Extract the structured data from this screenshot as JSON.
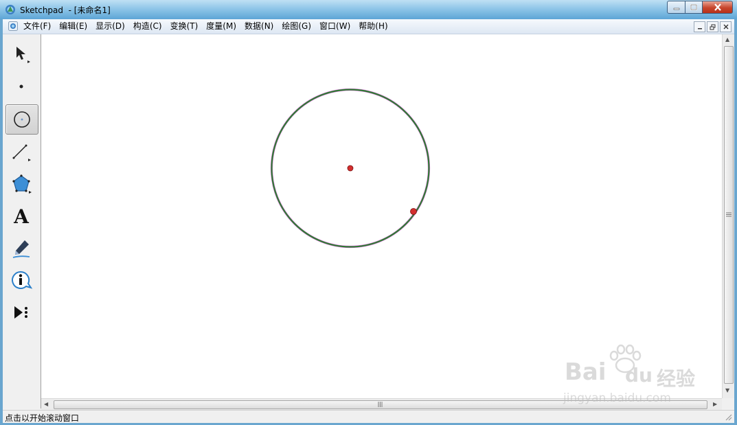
{
  "window": {
    "title": "Sketchpad  - [未命名1]"
  },
  "menubar": {
    "items": [
      {
        "label": "文件(F)"
      },
      {
        "label": "编辑(E)"
      },
      {
        "label": "显示(D)"
      },
      {
        "label": "构造(C)"
      },
      {
        "label": "变换(T)"
      },
      {
        "label": "度量(M)"
      },
      {
        "label": "数据(N)"
      },
      {
        "label": "绘图(G)"
      },
      {
        "label": "窗口(W)"
      },
      {
        "label": "帮助(H)"
      }
    ]
  },
  "toolbox": {
    "tools": [
      {
        "icon": "arrow-select-icon",
        "active": false
      },
      {
        "icon": "point-tool-icon",
        "active": false
      },
      {
        "icon": "compass-tool-icon",
        "active": true
      },
      {
        "icon": "straightedge-tool-icon",
        "active": false
      },
      {
        "icon": "polygon-tool-icon",
        "active": false
      },
      {
        "icon": "text-tool-icon",
        "active": false
      },
      {
        "icon": "marker-tool-icon",
        "active": false
      },
      {
        "icon": "information-tool-icon",
        "active": false
      },
      {
        "icon": "custom-tool-icon",
        "active": false
      }
    ],
    "text_tool_glyph": "A"
  },
  "canvas": {
    "circle_color": "#2e7d32",
    "highlight_color": "#e066e0",
    "point_color": "#d32f2f"
  },
  "status": {
    "text": "点击以开始滚动窗口"
  },
  "watermark": {
    "brand": "Bai",
    "brand_suffix": "du",
    "cn": "经验",
    "url": "jingyan.baidu.com"
  }
}
